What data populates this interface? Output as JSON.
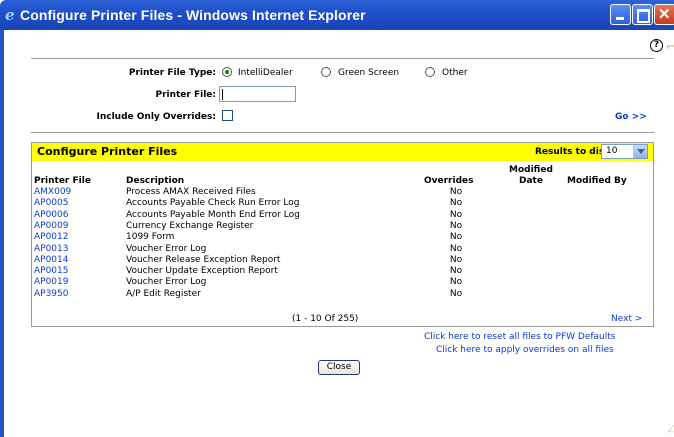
{
  "window": {
    "title": "Configure Printer Files - Windows Internet Explorer"
  },
  "filters": {
    "type_label": "Printer File Type:",
    "type_options": [
      "IntelliDealer",
      "Green Screen",
      "Other"
    ],
    "type_selected": "IntelliDealer",
    "file_label": "Printer File:",
    "file_value": "",
    "overrides_label": "Include Only Overrides:",
    "overrides_checked": false,
    "go_label": "Go >>"
  },
  "panel": {
    "title": "Configure Printer Files",
    "results_label": "Results to display:",
    "results_value": "10",
    "columns": {
      "file": "Printer File",
      "desc": "Description",
      "overrides": "Overrides",
      "modified_date_1": "Modified",
      "modified_date_2": "Date",
      "modified_by": "Modified By"
    },
    "rows": [
      {
        "file": "AMX009",
        "desc": "Process AMAX Received Files",
        "overrides": "No"
      },
      {
        "file": "AP0005",
        "desc": "Accounts Payable Check Run Error Log",
        "overrides": "No"
      },
      {
        "file": "AP0006",
        "desc": "Accounts Payable Month End Error Log",
        "overrides": "No"
      },
      {
        "file": "AP0009",
        "desc": "Currency Exchange Register",
        "overrides": "No"
      },
      {
        "file": "AP0012",
        "desc": "1099 Form",
        "overrides": "No"
      },
      {
        "file": "AP0013",
        "desc": "Voucher Error Log",
        "overrides": "No"
      },
      {
        "file": "AP0014",
        "desc": "Voucher Release Exception Report",
        "overrides": "No"
      },
      {
        "file": "AP0015",
        "desc": "Voucher Update Exception Report",
        "overrides": "No"
      },
      {
        "file": "AP0019",
        "desc": "Voucher Error Log",
        "overrides": "No"
      },
      {
        "file": "AP3950",
        "desc": "A/P Edit Register",
        "overrides": "No"
      }
    ],
    "pager": "(1 - 10 Of 255)",
    "next_label": "Next >"
  },
  "links": {
    "reset": "Click here to reset all files to PFW Defaults",
    "apply": "Click here to apply overrides on all files"
  },
  "close_label": "Close",
  "colors": {
    "titlebar": "#1f4fc9",
    "panel_header": "#ffff00",
    "link": "#0b3bd6"
  }
}
